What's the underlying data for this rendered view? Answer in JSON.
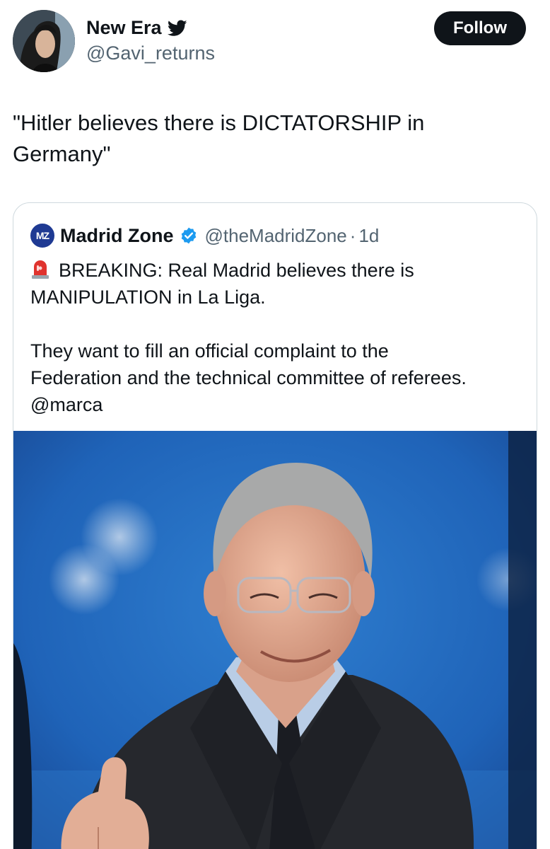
{
  "tweet": {
    "author": {
      "name": "New Era",
      "handle": "@Gavi_returns",
      "badge_icon": "twitter-bird-icon",
      "avatar_icon": "avatar-photo"
    },
    "follow_label": "Follow",
    "text_line1": "\"Hitler believes there is DICTATORSHIP in",
    "text_line2": "Germany\""
  },
  "quote": {
    "logo_text": "MZ",
    "name": "Madrid Zone",
    "handle": "@theMadridZone",
    "separator": "·",
    "time": "1d",
    "line1": "BREAKING: Real Madrid believes there is",
    "line2": "MANIPULATION in La Liga.",
    "line3": "They want to fill an official complaint to the",
    "line4": "Federation and the technical committee of referees.",
    "line5": "@marca",
    "media_icon": "photo-man-thumbs-up"
  },
  "colors": {
    "text": "#0f1419",
    "secondary": "#536471",
    "verified": "#1d9bf0",
    "follow_bg": "#0f1419",
    "border": "#cfd9de",
    "photo_bg": "#1f63b8"
  }
}
